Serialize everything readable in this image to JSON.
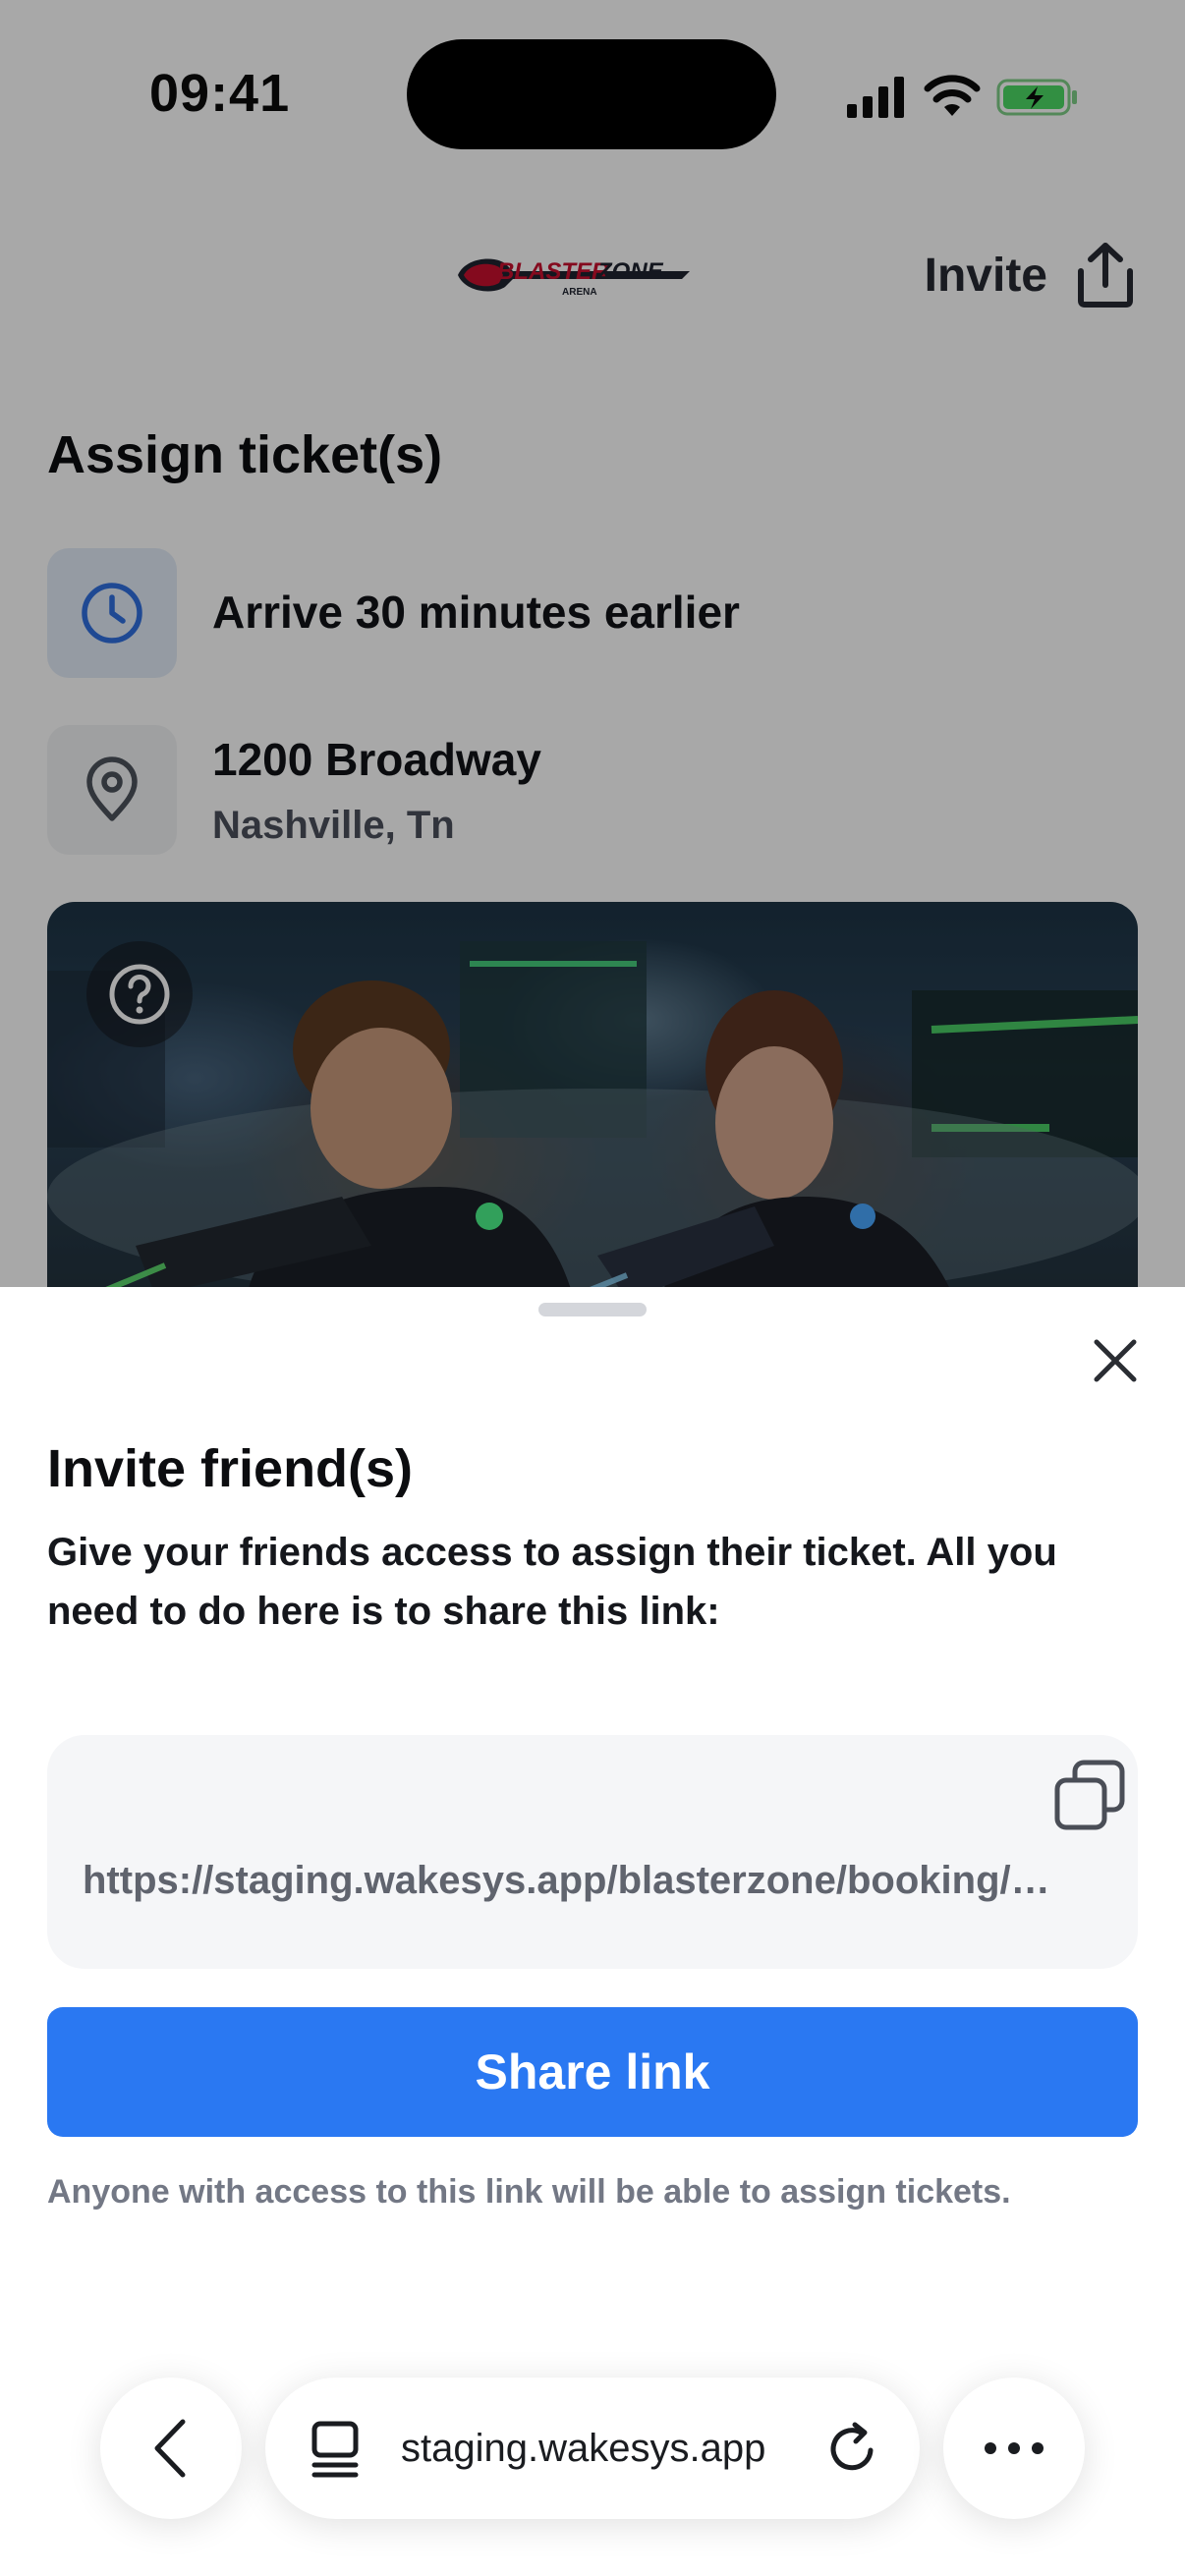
{
  "status_bar": {
    "time": "09:41"
  },
  "header": {
    "logo_text": "BLASTERZONE",
    "logo_subtext": "ARENA",
    "invite_label": "Invite"
  },
  "page": {
    "title": "Assign ticket(s)",
    "arrival_note": "Arrive 30 minutes earlier",
    "address_line1": "1200 Broadway",
    "address_line2": "Nashville, Tn"
  },
  "sheet": {
    "title": "Invite friend(s)",
    "description": "Give your friends access to assign their ticket. All you need to do here is to share this link:",
    "link": "https://staging.wakesys.app/blasterzone/booking/…",
    "share_button": "Share link",
    "notice": "Anyone with access to this link will be able to assign tickets."
  },
  "browser": {
    "url": "staging.wakesys.app"
  },
  "colors": {
    "accent": "#2a78f2",
    "clock_icon": "#2f6fe0",
    "battery_fill": "#4cd964",
    "logo_red": "#c8102e"
  },
  "icons": {
    "header": [
      "share-icon"
    ],
    "info": [
      "clock-icon",
      "location-pin-icon"
    ],
    "sheet": [
      "close-icon",
      "copy-icon"
    ],
    "browser": [
      "chevron-left-icon",
      "tabs-icon",
      "reload-icon",
      "more-icon"
    ]
  }
}
